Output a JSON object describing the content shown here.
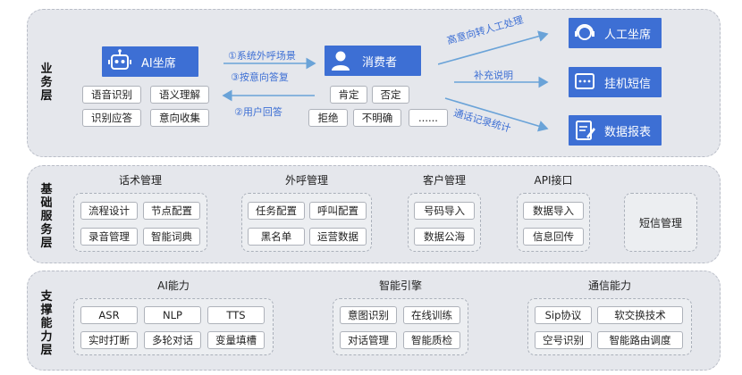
{
  "layers": {
    "business": "业务层",
    "foundation": "基础服务层",
    "support": "支撑能力层"
  },
  "business": {
    "ai_agent": "AI坐席",
    "ai_skills": [
      "语音识别",
      "语义理解",
      "识别应答",
      "意向收集"
    ],
    "consumer": "消费者",
    "consumer_replies": [
      "肯定",
      "否定",
      "拒绝",
      "不明确",
      "......"
    ],
    "flow_steps": [
      "①系统外呼场景",
      "③按意向答复",
      "②用户回答"
    ],
    "outputs": [
      {
        "label": "人工坐席",
        "icon": "headset-agent-icon"
      },
      {
        "label": "挂机短信",
        "icon": "message-icon"
      },
      {
        "label": "数据报表",
        "icon": "report-icon"
      }
    ],
    "output_arrows": [
      "高意向转人工处理",
      "补充说明",
      "通话记录统计"
    ]
  },
  "foundation": {
    "script_mgmt": {
      "title": "话术管理",
      "items": [
        "流程设计",
        "节点配置",
        "录音管理",
        "智能词典"
      ]
    },
    "call_mgmt": {
      "title": "外呼管理",
      "items": [
        "任务配置",
        "呼叫配置",
        "黑名单",
        "运营数据"
      ]
    },
    "customer_mgmt": {
      "title": "客户管理",
      "items": [
        "号码导入",
        "数据公海"
      ]
    },
    "api": {
      "title": "API接口",
      "items": [
        "数据导入",
        "信息回传"
      ]
    },
    "sms": "短信管理"
  },
  "support": {
    "ai": {
      "title": "AI能力",
      "items": [
        "ASR",
        "NLP",
        "TTS",
        "实时打断",
        "多轮对话",
        "变量填槽"
      ]
    },
    "engine": {
      "title": "智能引擎",
      "items": [
        "意图识别",
        "在线训练",
        "对话管理",
        "智能质检"
      ]
    },
    "telecom": {
      "title": "通信能力",
      "items": [
        "Sip协议",
        "软交换技术",
        "空号识别",
        "智能路由调度"
      ]
    }
  },
  "colors": {
    "accent": "#3d6fd4",
    "layer_bg": "#e5e7ec",
    "arrow": "#6aa3d8"
  }
}
